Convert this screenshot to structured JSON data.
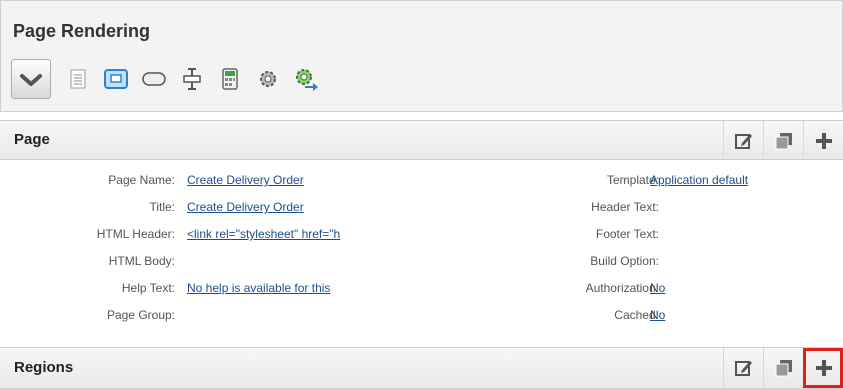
{
  "header": {
    "title": "Page Rendering",
    "toolbar_icons": [
      "checkmark-icon",
      "page-icon",
      "region-icon",
      "button-icon",
      "item-icon",
      "calculator-icon",
      "gear-icon",
      "gear-arrow-icon"
    ]
  },
  "page_section": {
    "title": "Page",
    "actions": [
      "edit-icon",
      "copy-icon",
      "plus-icon"
    ],
    "left_props": [
      {
        "label": "Page Name:",
        "value": "Create Delivery Order"
      },
      {
        "label": "Title:",
        "value": "Create Delivery Order"
      },
      {
        "label": "HTML Header:",
        "value": "<link rel=\"stylesheet\" href=\"h"
      },
      {
        "label": "HTML Body:",
        "value": ""
      },
      {
        "label": "Help Text:",
        "value": "No help is available for this"
      },
      {
        "label": "Page Group:",
        "value": ""
      }
    ],
    "right_props": [
      {
        "label": "Template:",
        "value": "Application default"
      },
      {
        "label": "Header Text:",
        "value": ""
      },
      {
        "label": "Footer Text:",
        "value": ""
      },
      {
        "label": "Build Option:",
        "value": ""
      },
      {
        "label": "Authorization:",
        "value": "No"
      },
      {
        "label": "Cached:",
        "value": "No"
      }
    ]
  },
  "regions_section": {
    "title": "Regions",
    "actions": [
      "edit-icon",
      "copy-icon",
      "plus-icon"
    ]
  },
  "colors": {
    "link": "#1f4e8f",
    "highlight": "#e0201b"
  }
}
